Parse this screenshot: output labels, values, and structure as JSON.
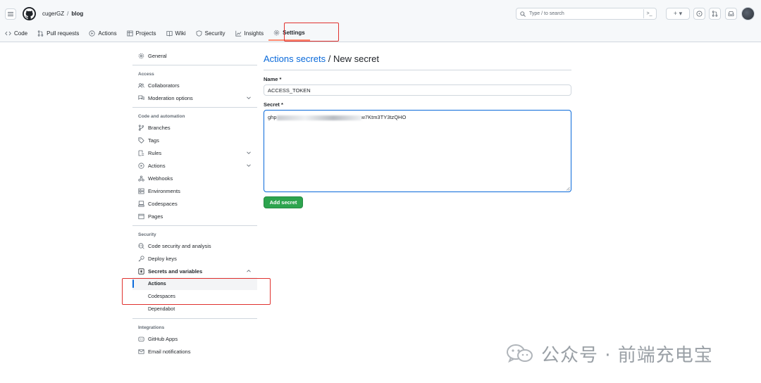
{
  "header": {
    "owner": "cugerGZ",
    "separator": "/",
    "repo": "blog",
    "search_placeholder": "Type / to search",
    "search_cmd": ">_",
    "plus": "+ ▾"
  },
  "tabs": [
    {
      "label": "Code",
      "icon": "code-icon"
    },
    {
      "label": "Pull requests",
      "icon": "pull-request-icon"
    },
    {
      "label": "Actions",
      "icon": "play-icon"
    },
    {
      "label": "Projects",
      "icon": "table-icon"
    },
    {
      "label": "Wiki",
      "icon": "book-icon"
    },
    {
      "label": "Security",
      "icon": "shield-icon"
    },
    {
      "label": "Insights",
      "icon": "graph-icon"
    },
    {
      "label": "Settings",
      "icon": "gear-icon",
      "active": true
    }
  ],
  "sidebar": {
    "general": "General",
    "access_heading": "Access",
    "collaborators": "Collaborators",
    "moderation": "Moderation options",
    "code_heading": "Code and automation",
    "branches": "Branches",
    "tags": "Tags",
    "rules": "Rules",
    "actions": "Actions",
    "webhooks": "Webhooks",
    "environments": "Environments",
    "codespaces": "Codespaces",
    "pages": "Pages",
    "security_heading": "Security",
    "code_security": "Code security and analysis",
    "deploy_keys": "Deploy keys",
    "secrets_vars": "Secrets and variables",
    "sub_actions": "Actions",
    "sub_codespaces": "Codespaces",
    "sub_dependabot": "Dependabot",
    "integrations_heading": "Integrations",
    "github_apps": "GitHub Apps",
    "email_notifications": "Email notifications"
  },
  "main": {
    "title_link": "Actions secrets",
    "title_rest": " / New secret",
    "name_label": "Name *",
    "name_value": "ACCESS_TOKEN",
    "secret_label": "Secret *",
    "secret_prefix": "ghp",
    "secret_suffix": "w7Ktm3TY3tzQHO",
    "add_button": "Add secret"
  },
  "watermark": {
    "text": "公众号 · 前端充电宝"
  },
  "colors": {
    "accent": "#0969da",
    "green_button": "#2da44e",
    "highlight_red": "#e0322f",
    "active_tab_underline": "#fd8c73"
  }
}
